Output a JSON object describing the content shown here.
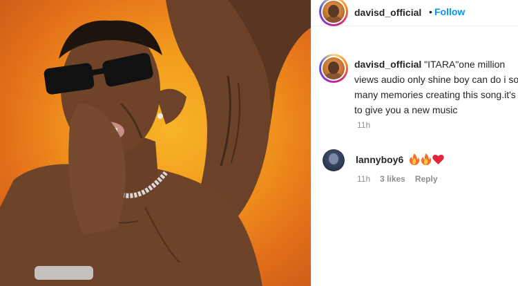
{
  "post": {
    "author": "davisd_official",
    "separator": "•",
    "follow_label": "Follow",
    "caption_user": "davisd_official",
    "caption_text": "\"ITARA\"one million views audio only shine boy can do i so many memories creating this song.it's to give you a new music",
    "caption_time": "11h"
  },
  "comment": {
    "user": "lannyboy6",
    "emojis": [
      "fire",
      "fire",
      "red-heart"
    ],
    "time": "11h",
    "likes": "3 likes",
    "reply_label": "Reply"
  },
  "colors": {
    "background_photo": "#f29a1c",
    "link_blue": "#0095f6",
    "muted_text": "#8e8e8e"
  }
}
